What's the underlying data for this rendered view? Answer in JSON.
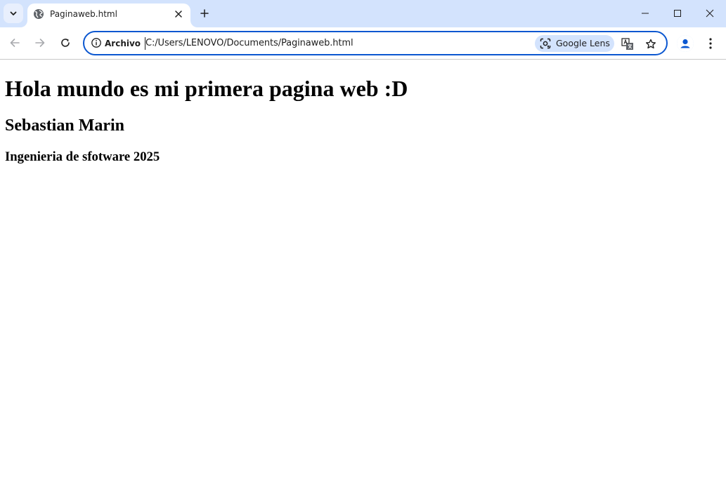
{
  "browser": {
    "tab": {
      "title": "Paginaweb.html"
    },
    "omnibox": {
      "security_label": "Archivo",
      "url": "C:/Users/LENOVO/Documents/Paginaweb.html",
      "lens_label": "Google Lens"
    },
    "accent_color": "#0b57d0",
    "tabstrip_color": "#d3e3fd"
  },
  "page": {
    "heading1": "Hola mundo es mi primera pagina web :D",
    "heading2": "Sebastian Marin",
    "heading3": "Ingenieria de sfotware 2025"
  }
}
